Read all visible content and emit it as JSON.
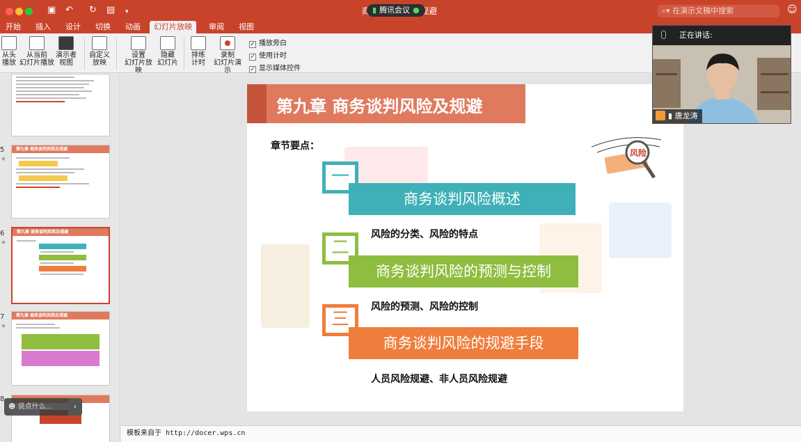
{
  "app": {
    "doc_title": "商务谈判风险及规避",
    "meeting_label": "腾讯会议",
    "search_placeholder": "在演示文稿中搜索"
  },
  "tabs": [
    "开始",
    "插入",
    "设计",
    "切换",
    "动画",
    "幻灯片放映",
    "审阅",
    "视图"
  ],
  "active_tab": "幻灯片放映",
  "ribbon": {
    "buttons": [
      {
        "line1": "从头",
        "line2": "播放"
      },
      {
        "line1": "从当前",
        "line2": "幻灯片播放"
      },
      {
        "line1": "演示者",
        "line2": "视图"
      },
      {
        "line1": "自定义",
        "line2": "放映"
      },
      {
        "line1": "设置",
        "line2": "幻灯片放映"
      },
      {
        "line1": "隐藏",
        "line2": "幻灯片"
      },
      {
        "line1": "排练",
        "line2": "计时"
      },
      {
        "line1": "录制",
        "line2": "幻灯片演示"
      }
    ],
    "checkboxes": [
      "播放旁白",
      "使用计时",
      "显示媒体控件"
    ]
  },
  "thumbnails": [
    {
      "num": "5",
      "title": "第九章 商务谈判风险及规避"
    },
    {
      "num": "6",
      "title": "第九章 商务谈判风险及规避"
    },
    {
      "num": "7",
      "title": "第九章 商务谈判风险及规避"
    },
    {
      "num": "8",
      "title": ""
    }
  ],
  "chat_placeholder": "说点什么...",
  "slide": {
    "title": "第九章 商务谈判风险及规避",
    "key_points_label": "章节要点：",
    "stamp_text": "风险",
    "sections": [
      {
        "num": "一",
        "heading": "商务谈判风险概述",
        "sub": "风险的分类、风险的特点",
        "color": "#3fb0b7"
      },
      {
        "num": "二",
        "heading": "商务谈判风险的预测与控制",
        "sub": "风险的预测、风险的控制",
        "color": "#8fbd3f"
      },
      {
        "num": "三",
        "heading": "商务谈判风险的规避手段",
        "sub": "人员风险规避、非人员风险规避",
        "color": "#ef7d3c"
      }
    ]
  },
  "notes_text": "模板来自于 http://docer.wps.cn",
  "video": {
    "speaking_label": "正在讲话:",
    "speaker_name": "唐龙涛"
  }
}
